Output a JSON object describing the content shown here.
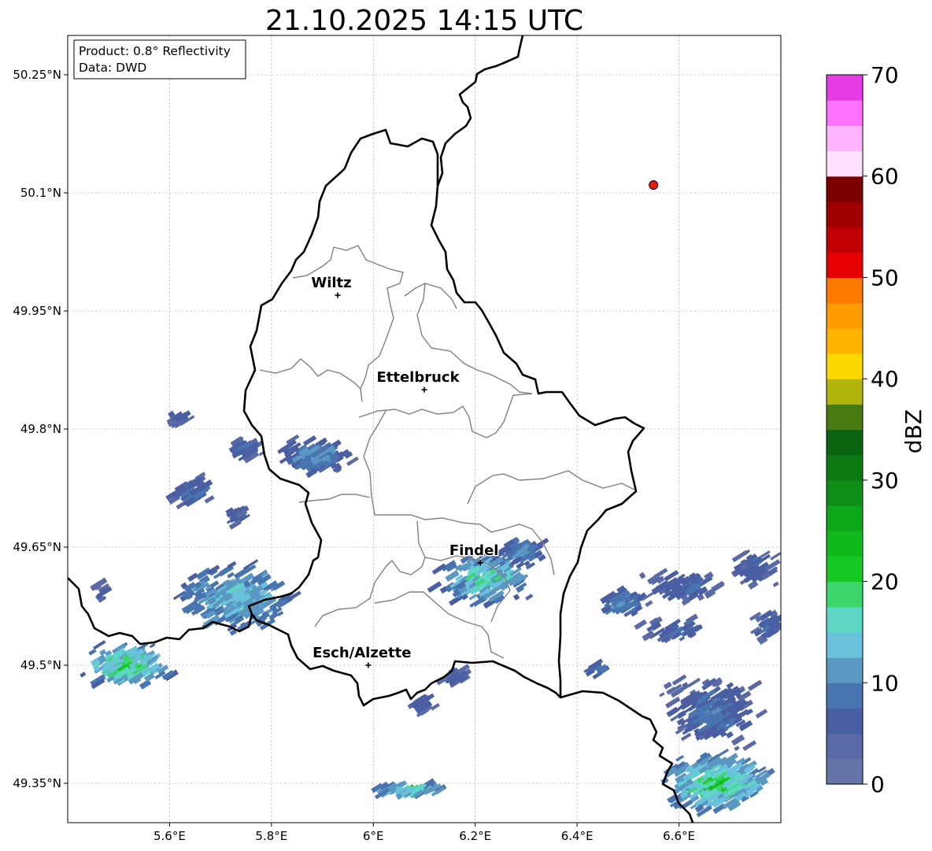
{
  "title": "21.10.2025 14:15 UTC",
  "info_box": {
    "product": "Product: 0.8° Reflectivity",
    "source": "Data: DWD"
  },
  "map_extent": {
    "lon": [
      5.4,
      6.8
    ],
    "lat": [
      49.3,
      50.3
    ]
  },
  "lon_ticks": [
    "5.6°E",
    "5.8°E",
    "6°E",
    "6.2°E",
    "6.4°E",
    "6.6°E"
  ],
  "lat_ticks": [
    "50.25°N",
    "50.1°N",
    "49.95°N",
    "49.8°N",
    "49.65°N",
    "49.5°N",
    "49.35°N"
  ],
  "cities": [
    {
      "name": "Wiltz",
      "lon": 5.93,
      "lat": 49.97
    },
    {
      "name": "Ettelbruck",
      "lon": 6.1,
      "lat": 49.85
    },
    {
      "name": "Findel",
      "lon": 6.21,
      "lat": 49.63
    },
    {
      "name": "Esch/Alzette",
      "lon": 5.99,
      "lat": 49.5
    }
  ],
  "radar_site": {
    "lon": 6.55,
    "lat": 50.11,
    "color": "#e41a1c"
  },
  "colorbar": {
    "label": "dBZ",
    "ticks": [
      "0",
      "10",
      "20",
      "30",
      "40",
      "50",
      "60",
      "70"
    ],
    "min": 0,
    "max": 70,
    "step": 2.5,
    "colors": [
      "#6674a8",
      "#5a6aa6",
      "#4a5fa3",
      "#4875b0",
      "#5a97c3",
      "#6ac1dc",
      "#5ed6c5",
      "#3dd56d",
      "#14c924",
      "#10b91b",
      "#0ea61a",
      "#0e8e17",
      "#0c7a13",
      "#0a6410",
      "#4a7a12",
      "#b0b40c",
      "#ffd800",
      "#ffb400",
      "#ff9c00",
      "#ff7a00",
      "#e60000",
      "#c00000",
      "#a00000",
      "#7a0000",
      "#ffe0ff",
      "#ffb4ff",
      "#ff72ff",
      "#e63be6"
    ]
  }
}
